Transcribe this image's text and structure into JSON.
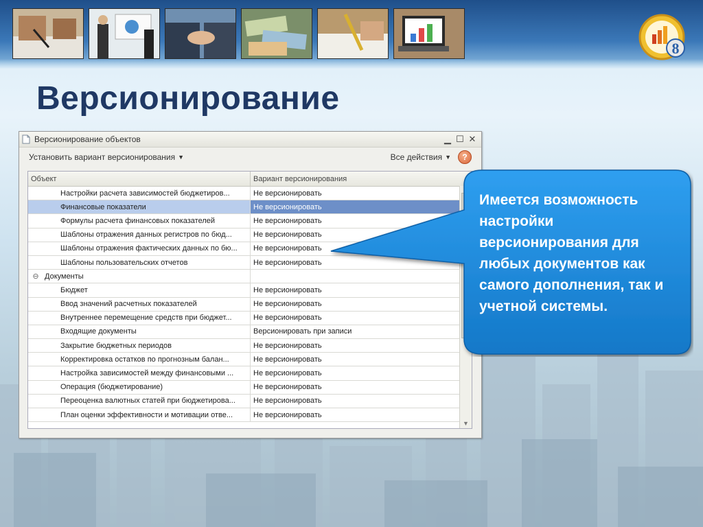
{
  "slide": {
    "title": "Версионирование"
  },
  "window": {
    "title": "Версионирование объектов",
    "toolbar": {
      "set_variant_label": "Установить вариант версионирования",
      "all_actions_label": "Все действия",
      "help_label": "?"
    },
    "columns": [
      "Объект",
      "Вариант версионирования"
    ],
    "rows": [
      {
        "object": "Настройки расчета зависимостей бюджетиров...",
        "variant": "Не версионировать",
        "group": false,
        "selected": false
      },
      {
        "object": "Финансовые показатели",
        "variant": "Не версионировать",
        "group": false,
        "selected": true
      },
      {
        "object": "Формулы расчета финансовых показателей",
        "variant": "Не версионировать",
        "group": false,
        "selected": false
      },
      {
        "object": "Шаблоны отражения данных регистров по бюд...",
        "variant": "Не версионировать",
        "group": false,
        "selected": false
      },
      {
        "object": "Шаблоны отражения фактических данных по бю...",
        "variant": "Не версионировать",
        "group": false,
        "selected": false
      },
      {
        "object": "Шаблоны пользовательских отчетов",
        "variant": "Не версионировать",
        "group": false,
        "selected": false
      },
      {
        "object": "Документы",
        "variant": "",
        "group": true,
        "selected": false
      },
      {
        "object": "Бюджет",
        "variant": "Не версионировать",
        "group": false,
        "selected": false
      },
      {
        "object": "Ввод значений расчетных показателей",
        "variant": "Не версионировать",
        "group": false,
        "selected": false
      },
      {
        "object": "Внутреннее перемещение средств при бюджет...",
        "variant": "Не версионировать",
        "group": false,
        "selected": false
      },
      {
        "object": "Входящие документы",
        "variant": "Версионировать при записи",
        "group": false,
        "selected": false
      },
      {
        "object": "Закрытие бюджетных периодов",
        "variant": "Не версионировать",
        "group": false,
        "selected": false
      },
      {
        "object": "Корректировка остатков по прогнозным балан...",
        "variant": "Не версионировать",
        "group": false,
        "selected": false
      },
      {
        "object": "Настройка зависимостей между финансовыми ...",
        "variant": "Не версионировать",
        "group": false,
        "selected": false
      },
      {
        "object": "Операция (бюджетирование)",
        "variant": "Не версионировать",
        "group": false,
        "selected": false
      },
      {
        "object": "Переоценка валютных статей при бюджетирова...",
        "variant": "Не версионировать",
        "group": false,
        "selected": false
      },
      {
        "object": "План оценки эффективности и мотивации отве...",
        "variant": "Не версионировать",
        "group": false,
        "selected": false
      }
    ]
  },
  "callout": {
    "text": "Имеется возможность настройки версионирования для любых документов как самого дополнения, так и учетной системы."
  },
  "logo": {
    "number": "8"
  },
  "photos": [
    "hands-writing-photo",
    "presentation-photo",
    "handshake-photo",
    "banknotes-photo",
    "pen-signing-photo",
    "laptop-chart-photo"
  ],
  "colors": {
    "title": "#1f3864",
    "callout_fill": "#1f8be0",
    "selection": "#6d8fc8"
  }
}
